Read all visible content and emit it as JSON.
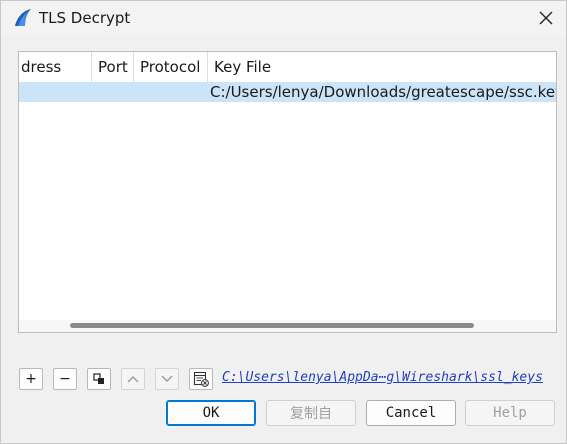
{
  "window": {
    "title": "TLS Decrypt",
    "icon": "wireshark-fin-icon"
  },
  "table": {
    "columns": [
      "dress",
      "Port",
      "Protocol",
      "Key File"
    ],
    "rows": [
      {
        "address": "",
        "port": "",
        "protocol": "",
        "key_file": "C:/Users/lenya/Downloads/greatescape/ssc.key"
      }
    ]
  },
  "toolbar": {
    "add_label": "+",
    "remove_label": "−",
    "copy_icon": "copy-icon",
    "up_icon": "chevron-up-icon",
    "down_icon": "chevron-down-icon",
    "clear_icon": "clear-table-icon"
  },
  "keylog_link": "C:\\Users\\lenya\\AppDa⋯g\\Wireshark\\ssl_keys",
  "buttons": {
    "ok": "OK",
    "copy_from": "复制自",
    "cancel": "Cancel",
    "help": "Help"
  },
  "colors": {
    "selection": "#cce4f7",
    "link": "#1f3fbf",
    "accent": "#0078d4",
    "app_icon": "#1c5fb8"
  }
}
